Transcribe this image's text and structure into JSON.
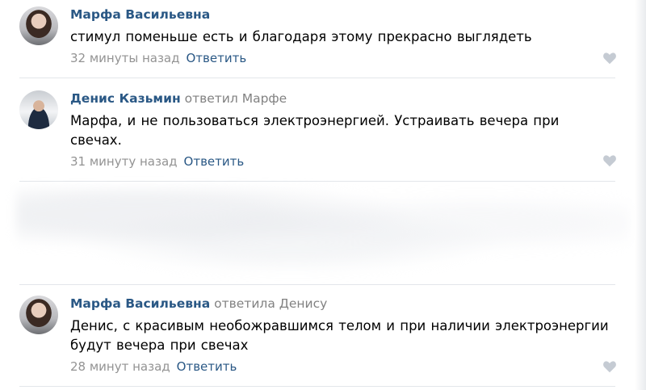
{
  "comments": [
    {
      "author": "Марфа Васильевна",
      "reply_note": "",
      "text": "стимул поменьше есть и благодаря этому прекрасно выглядеть",
      "time": "32 минуты назад",
      "reply_label": "Ответить",
      "avatar_icon": "user-photo-marfa"
    },
    {
      "author": "Денис Казьмин",
      "reply_note": "ответил Марфе",
      "text": "Марфа, и не пользоваться электроэнергией. Устраивать вечера при свечах.",
      "time": "31 минуту назад",
      "reply_label": "Ответить",
      "avatar_icon": "user-photo-denis"
    },
    {
      "author": "Марфа Васильевна",
      "reply_note": "ответила Денису",
      "text": "Денис, с красивым необожравшимся телом и при наличии электроэнергии будут вечера при свечах",
      "time": "28 минут назад",
      "reply_label": "Ответить",
      "avatar_icon": "user-photo-marfa"
    }
  ],
  "colors": {
    "author": "#2a5885",
    "meta": "#939393",
    "divider": "#e3e6ea",
    "like_icon": "#c5cbd3"
  }
}
